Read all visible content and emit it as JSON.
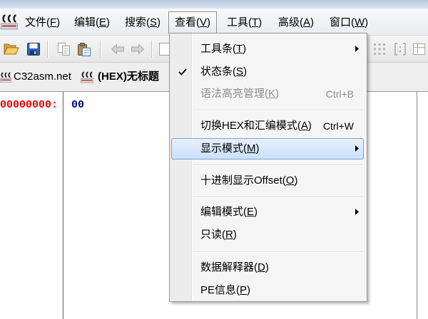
{
  "menubar": {
    "app_icon": "app-logo-icon",
    "items": [
      {
        "label": "文件(F)"
      },
      {
        "label": "编辑(E)"
      },
      {
        "label": "搜索(S)"
      },
      {
        "label": "查看(V)",
        "open": true
      },
      {
        "label": "工具(T)"
      },
      {
        "label": "高级(A)"
      },
      {
        "label": "窗口(W)"
      }
    ]
  },
  "toolbar": {
    "buttons": [
      {
        "icon": "open-folder-icon"
      },
      {
        "icon": "save-icon"
      },
      {
        "icon": "copy-icon",
        "disabled": true
      },
      {
        "icon": "paste-icon"
      },
      {
        "icon": "back-arrow-icon",
        "disabled": true
      },
      {
        "icon": "forward-arrow-icon",
        "disabled": true
      },
      {
        "icon": "page-icon",
        "disabled": true
      },
      {
        "icon": "dotted-grid-icon",
        "disabled": true
      },
      {
        "icon": "bracket-icon",
        "disabled": true
      },
      {
        "icon": "table-icon",
        "disabled": true
      }
    ]
  },
  "tabs": [
    {
      "label": "C32asm.net",
      "icon": "app-logo-icon",
      "active": false
    },
    {
      "label": "(HEX)无标题",
      "icon": "app-logo-icon",
      "active": true
    }
  ],
  "editor": {
    "rows": [
      {
        "offset": "00000000:",
        "bytes": "00"
      }
    ]
  },
  "view_menu": {
    "items": [
      {
        "label": "工具条(T)",
        "has_submenu": true
      },
      {
        "label": "状态条(S)",
        "checked": true
      },
      {
        "label": "语法高亮管理(K)",
        "shortcut": "Ctrl+B",
        "disabled": true
      },
      {
        "label": "切换HEX和汇编模式(A)",
        "shortcut": "Ctrl+W"
      },
      {
        "label": "显示模式(M)",
        "has_submenu": true,
        "highlighted": true
      },
      {
        "label": "十进制显示Offset(O)"
      },
      {
        "label": "编辑模式(E)",
        "has_submenu": true
      },
      {
        "label": "只读(R)"
      },
      {
        "label": "数据解释器(D)"
      },
      {
        "label": "PE信息(P)"
      }
    ]
  },
  "colors": {
    "offset_text": "#e00000",
    "byte_text": "#00008b",
    "menu_highlight_border": "#7da2ce",
    "disabled_text": "#8d8d8d"
  }
}
